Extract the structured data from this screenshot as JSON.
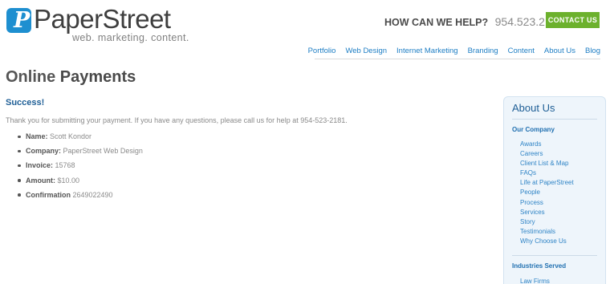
{
  "brand": {
    "name": "PaperStreet",
    "tagline": "web. marketing. content.",
    "mark": "P",
    "colors": {
      "blue": "#1e8fd0",
      "green": "#6cb12d",
      "heading_blue": "#1f5f96"
    }
  },
  "header": {
    "help_label": "HOW CAN WE HELP?",
    "help_phone": "954.523.2181",
    "contact_label": "CONTACT US"
  },
  "nav": {
    "items": [
      {
        "label": "Portfolio"
      },
      {
        "label": "Web Design"
      },
      {
        "label": "Internet Marketing"
      },
      {
        "label": "Branding"
      },
      {
        "label": "Content"
      },
      {
        "label": "About Us"
      },
      {
        "label": "Blog"
      }
    ]
  },
  "main": {
    "title_light": "Online ",
    "title_bold": "Payments",
    "success": "Success!",
    "intro": "Thank you for submitting your payment. If you have any questions, please call us for help at 954-523-2181.",
    "details": [
      {
        "label": "Name:",
        "value": " Scott Kondor"
      },
      {
        "label": "Company:",
        "value": " PaperStreet Web Design"
      },
      {
        "label": "Invoice:",
        "value": " 15768"
      },
      {
        "label": "Amount:",
        "value": " $10.00"
      },
      {
        "label": "Confirmation",
        "value": " 2649022490"
      }
    ]
  },
  "sidebar": {
    "title": "About Us",
    "section1": "Our Company",
    "links": [
      "Awards",
      "Careers",
      "Client List & Map",
      "FAQs",
      "Life at PaperStreet",
      "People",
      "Process",
      "Services",
      "Story",
      "Testimonials",
      "Why Choose Us"
    ],
    "section2": "Industries Served",
    "links2": [
      "Law Firms"
    ]
  }
}
